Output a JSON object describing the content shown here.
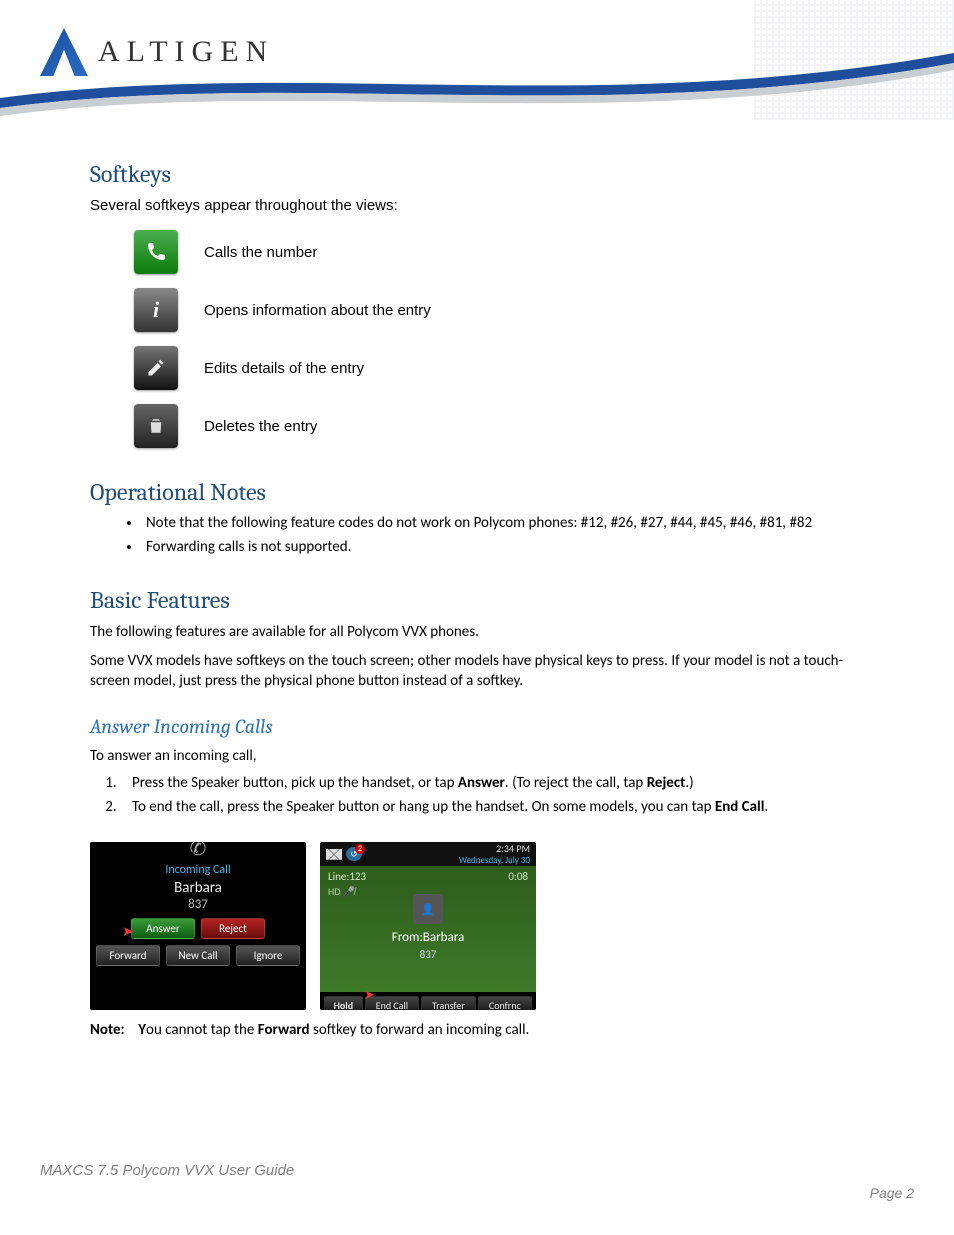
{
  "brand": "ALTIGEN",
  "h_softkeys": "Softkeys",
  "softkeys_intro": "Several softkeys appear throughout the views:",
  "sk": [
    {
      "icon": "phone",
      "label": "Calls the number"
    },
    {
      "icon": "info",
      "label": "Opens information about the entry"
    },
    {
      "icon": "edit",
      "label": "Edits details of the entry"
    },
    {
      "icon": "delete",
      "label": "Deletes the entry"
    }
  ],
  "h_opnotes": "Operational Notes",
  "opnotes": [
    "Note that the following feature codes do not work on Polycom phones: #12, #26, #27, #44, #45, #46, #81, #82",
    "Forwarding calls is not supported."
  ],
  "h_basic": "Basic Features",
  "basic_p1": "The following features are available for all Polycom VVX phones.",
  "basic_p2": "Some VVX models have softkeys on the touch screen; other models have physical keys to press. If your model is not a touch-screen model, just press the physical phone button instead of a softkey.",
  "h_answer": "Answer Incoming Calls",
  "answer_intro": "To answer an incoming call,",
  "steps": {
    "s1_a": "Press the Speaker button, pick up the handset, or tap ",
    "s1_b": "Answer",
    "s1_c": ".  (To reject the call, tap ",
    "s1_d": "Reject",
    "s1_e": ".)",
    "s2_a": "To end the call, press the Speaker button or hang up the handset. On some models, you can tap ",
    "s2_b": "End Call",
    "s2_c": "."
  },
  "shot1": {
    "incoming": "Incoming Call",
    "name": "Barbara",
    "num": "837",
    "answer": "Answer",
    "reject": "Reject",
    "forward": "Forward",
    "newcall": "New Call",
    "ignore": "Ignore"
  },
  "shot2": {
    "badge": "2",
    "time": "2:34 PM",
    "date": "Wednesday, July 30",
    "line": "Line:123",
    "dur": "0:08",
    "hd": "HD",
    "from": "From:Barbara",
    "num": "837",
    "hold": "Hold",
    "end": "End Call",
    "transfer": "Transfer",
    "conf": "Confrnc"
  },
  "note_label": "Note:",
  "note_a": "Y",
  "note_b": "ou cannot tap the ",
  "note_c": "Forward",
  "note_d": " softkey to forward an incoming call.",
  "footer_title": "MAXCS 7.5 Polycom VVX User Guide",
  "footer_page": "Page 2"
}
